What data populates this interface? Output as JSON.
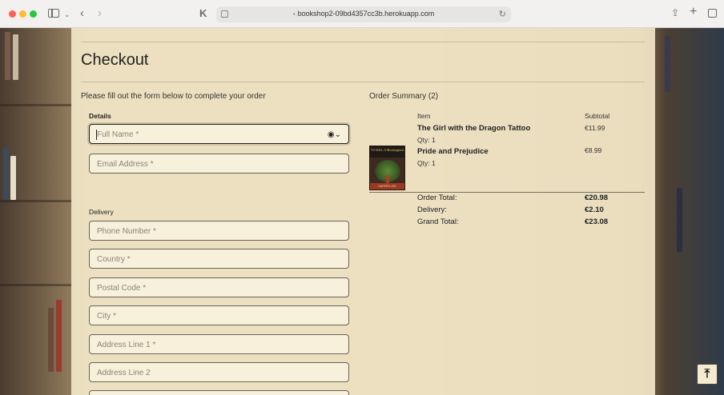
{
  "browser": {
    "url": "bookshop2-09bd4357cc3b.herokuapp.com",
    "lock_glyph": "🔒"
  },
  "page": {
    "title": "Checkout",
    "intro": "Please fill out the form below to complete your order"
  },
  "form": {
    "details_label": "Details",
    "full_name_placeholder": "Full Name *",
    "email_placeholder": "Email Address *",
    "delivery_label": "Delivery",
    "phone_placeholder": "Phone Number *",
    "country_placeholder": "Country *",
    "postcode_placeholder": "Postal Code *",
    "city_placeholder": "City *",
    "address1_placeholder": "Address Line 1 *",
    "address2_placeholder": "Address Line 2"
  },
  "summary": {
    "title": "Order Summary (2)",
    "col_item": "Item",
    "col_subtotal": "Subtotal",
    "items": [
      {
        "title": "The Girl with the Dragon Tattoo",
        "qty": "Qty: 1",
        "subtotal": "€11.99"
      },
      {
        "title": "Pride and Prejudice",
        "qty": "Qty: 1",
        "subtotal": "€8.99"
      }
    ],
    "order_total_label": "Order Total:",
    "order_total": "€20.98",
    "delivery_label": "Delivery:",
    "delivery": "€2.10",
    "grand_total_label": "Grand Total:",
    "grand_total": "€23.08"
  },
  "cover": {
    "top_text": "TO KILL A Mockingbird",
    "bottom_text": "HARPER LEE"
  },
  "colors": {
    "panel": "#f4e9ca",
    "text": "#222222",
    "field_border": "#6a6357"
  }
}
